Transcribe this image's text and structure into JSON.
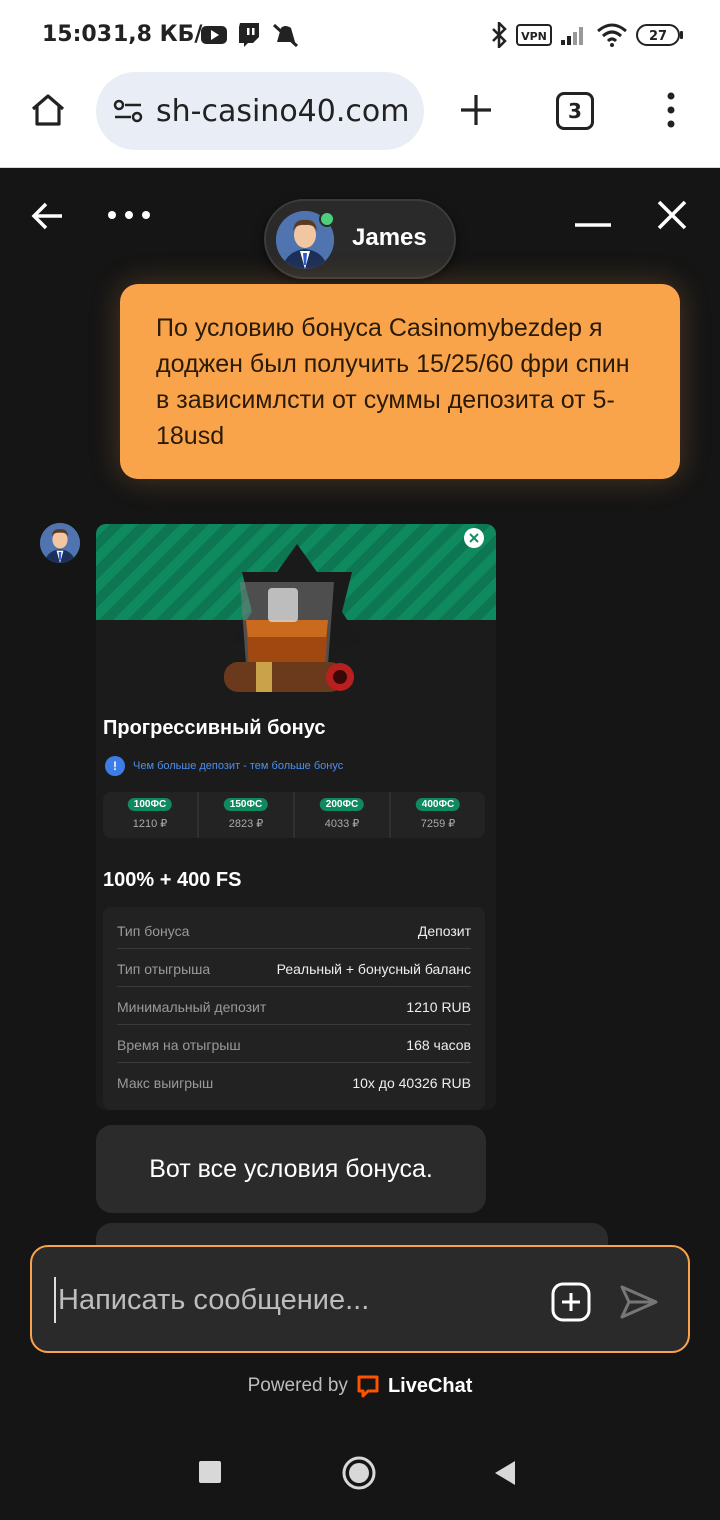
{
  "status_bar": {
    "time": "15:03",
    "net_speed": "1,8 КБ/с",
    "vpn_label": "VPN",
    "battery": "27"
  },
  "browser": {
    "url": "sh-casino40.com",
    "tab_count": "3"
  },
  "chat": {
    "agent_name": "James",
    "user_message": "По условию бонуса Casinomybezdep я доджен был получить 15/25/60 фри спин в зависимлсти от суммы депозита от 5-18usd",
    "promo": {
      "title": "Прогрессивный бонус",
      "note": "Чем больше депозит - тем больше бонус",
      "tiers": [
        {
          "badge": "100ФС",
          "amount": "1210 ₽"
        },
        {
          "badge": "150ФС",
          "amount": "2823 ₽"
        },
        {
          "badge": "200ФС",
          "amount": "4033 ₽"
        },
        {
          "badge": "400ФС",
          "amount": "7259 ₽"
        }
      ],
      "headline": "100% + 400 FS",
      "details": [
        {
          "label": "Тип бонуса",
          "value": "Депозит"
        },
        {
          "label": "Тип отыгрыша",
          "value": "Реальный + бонусный баланс"
        },
        {
          "label": "Минимальный депозит",
          "value": "1210 RUB"
        },
        {
          "label": "Время на отыгрыш",
          "value": "168 часов"
        },
        {
          "label": "Макс выигрыш",
          "value": "10x до 40326 RUB"
        }
      ]
    },
    "bot_message": "Вот все условия бонуса.",
    "input_placeholder": "Написать сообщение...",
    "powered_prefix": "Powered by",
    "powered_brand": "LiveChat"
  },
  "colors": {
    "accent": "#f9a44a",
    "background": "#151515",
    "promo_green": "#0f8a5f",
    "online": "#4cd07d"
  },
  "icons": [
    "home-icon",
    "site-settings-icon",
    "new-tab-icon",
    "tabs-icon",
    "menu-icon",
    "back-icon",
    "more-icon",
    "minimize-icon",
    "close-icon",
    "attach-icon",
    "send-icon",
    "livechat-logo-icon"
  ]
}
